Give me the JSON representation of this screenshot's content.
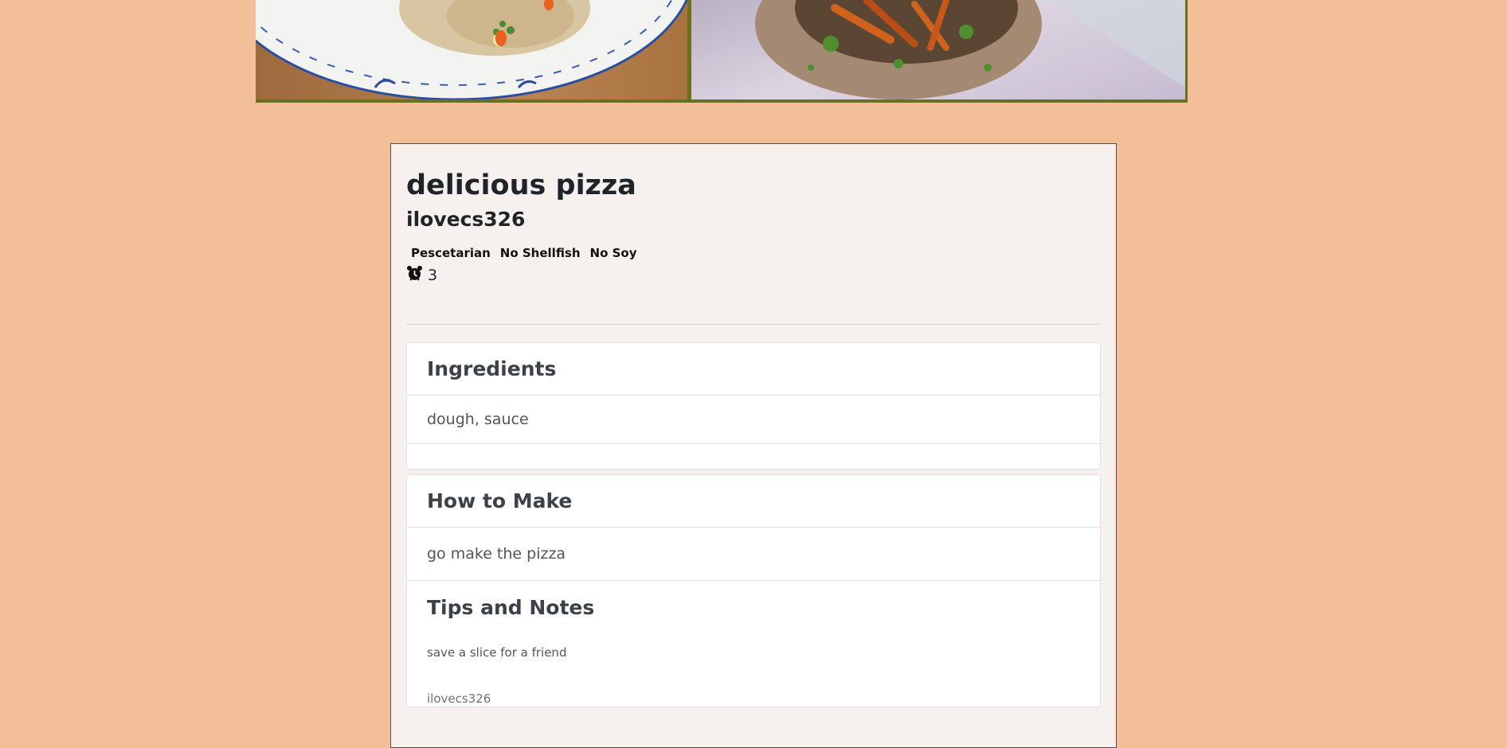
{
  "recipe": {
    "title": "delicious pizza",
    "author": "ilovecs326",
    "tags": [
      "Pescetarian",
      "No Shellfish",
      "No Soy"
    ],
    "time_icon": "alarm-clock-icon",
    "time_value": "3"
  },
  "ingredients": {
    "heading": "Ingredients",
    "text": "dough, sauce"
  },
  "method": {
    "heading": "How to Make",
    "text": "go make the pizza"
  },
  "tips": {
    "heading": "Tips and Notes",
    "text": "save a slice for a friend",
    "author": "ilovecs326"
  },
  "colors": {
    "page_background": "#f2bf99",
    "card_background": "#f6f0ee",
    "photo_frame": "#6b6f1e"
  }
}
